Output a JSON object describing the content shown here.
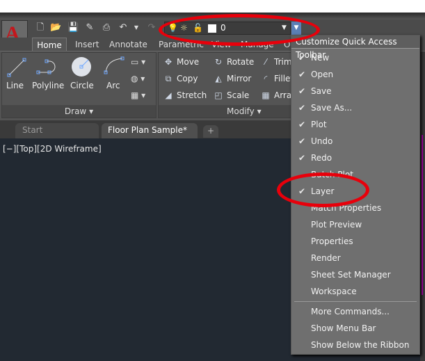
{
  "app": {
    "logo": "A",
    "brand_color": "#c4161c"
  },
  "qat": {
    "icons": [
      "new-icon",
      "open-icon",
      "save-icon",
      "save-as-icon",
      "plot-icon",
      "undo-icon",
      "redo-icon"
    ],
    "layer": {
      "current": "0",
      "icons": [
        "lightbulb-icon",
        "sun-icon",
        "unlock-icon",
        "color-swatch-icon"
      ]
    }
  },
  "ribbon": {
    "tabs": [
      "Home",
      "Insert",
      "Annotate",
      "Parametric",
      "View",
      "Manage",
      "O"
    ],
    "draw": {
      "title": "Draw",
      "tools": [
        "Line",
        "Polyline",
        "Circle",
        "Arc"
      ]
    },
    "modify": {
      "title": "Modify",
      "tools": [
        [
          "Move",
          "Rotate",
          "Trim"
        ],
        [
          "Copy",
          "Mirror",
          "Fillet"
        ],
        [
          "Stretch",
          "Scale",
          "Array"
        ]
      ]
    }
  },
  "doc_tabs": [
    "Start",
    "Floor Plan Sample*"
  ],
  "viewport": {
    "label": "[−][Top][2D Wireframe]"
  },
  "menu": {
    "title": "Customize Quick Access Toolbar",
    "items": [
      {
        "label": "New",
        "checked": true
      },
      {
        "label": "Open",
        "checked": true
      },
      {
        "label": "Save",
        "checked": true
      },
      {
        "label": "Save As...",
        "checked": true
      },
      {
        "label": "Plot",
        "checked": true
      },
      {
        "label": "Undo",
        "checked": true
      },
      {
        "label": "Redo",
        "checked": true
      },
      {
        "label": "Batch Plot",
        "checked": false
      },
      {
        "label": "Layer",
        "checked": true
      },
      {
        "label": "Match Properties",
        "checked": false
      },
      {
        "label": "Plot Preview",
        "checked": false
      },
      {
        "label": "Properties",
        "checked": false
      },
      {
        "label": "Render",
        "checked": false
      },
      {
        "label": "Sheet Set Manager",
        "checked": false
      },
      {
        "label": "Workspace",
        "checked": false
      }
    ],
    "extra": [
      "More Commands...",
      "Show Menu Bar",
      "Show Below the Ribbon"
    ]
  },
  "annotation_color": "#e8000b"
}
